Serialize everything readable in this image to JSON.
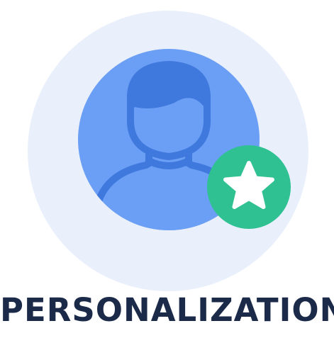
{
  "title": "PERSONALIZATION",
  "icons": {
    "avatar": "user-avatar-icon",
    "badge": "star-badge-icon"
  },
  "colors": {
    "background_circle": "#e9f0fc",
    "avatar_fill": "#6b9ef5",
    "avatar_outline": "#3f79dd",
    "badge_fill": "#2fc191",
    "star_fill": "#ffffff",
    "title_text": "#1c2a4a"
  }
}
